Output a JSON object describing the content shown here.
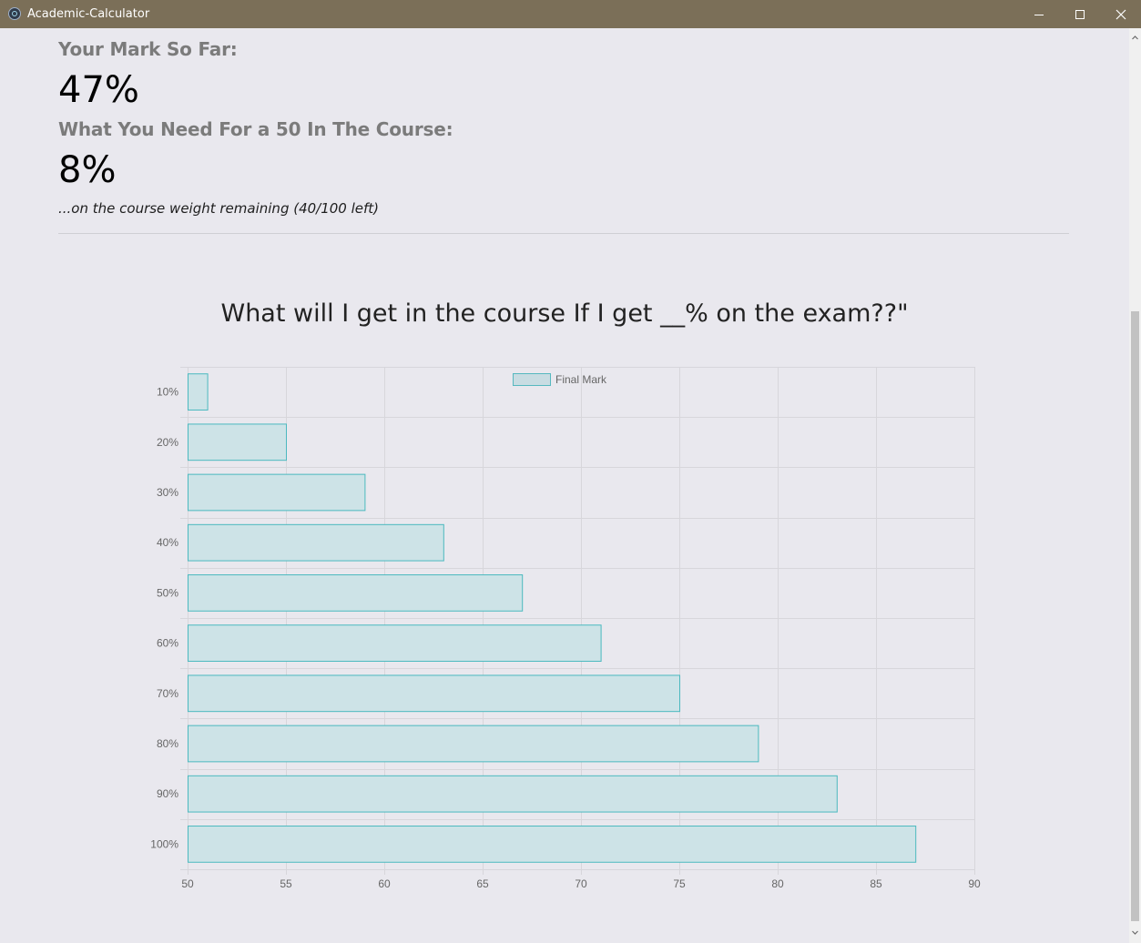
{
  "window": {
    "title": "Academic-Calculator",
    "app_icon": "electron-atom-icon",
    "controls": [
      "minimize-icon",
      "maximize-icon",
      "close-icon"
    ]
  },
  "summary": {
    "mark_label": "Your Mark So Far:",
    "mark_value": "47%",
    "need_label": "What You Need For a 50 In The Course:",
    "need_value": "8%",
    "remaining_note": "...on the course weight remaining (40/100 left)"
  },
  "chart_data": {
    "type": "bar",
    "orientation": "horizontal",
    "title": "What will I get in the course If I get __% on the exam??\"",
    "categories": [
      "10%",
      "20%",
      "30%",
      "40%",
      "50%",
      "60%",
      "70%",
      "80%",
      "90%",
      "100%"
    ],
    "series": [
      {
        "name": "Final Mark",
        "values": [
          51,
          55,
          59,
          63,
          67,
          71,
          75,
          79,
          83,
          87
        ]
      }
    ],
    "xlim": [
      50,
      90
    ],
    "xticks": [
      50,
      55,
      60,
      65,
      70,
      75,
      80,
      85,
      90
    ],
    "grid": true,
    "legend": "top-center",
    "colors": {
      "fill": "#cde3e7",
      "border": "#4bb9bf",
      "grid": "#d7d6db",
      "tick": "#666666"
    }
  }
}
